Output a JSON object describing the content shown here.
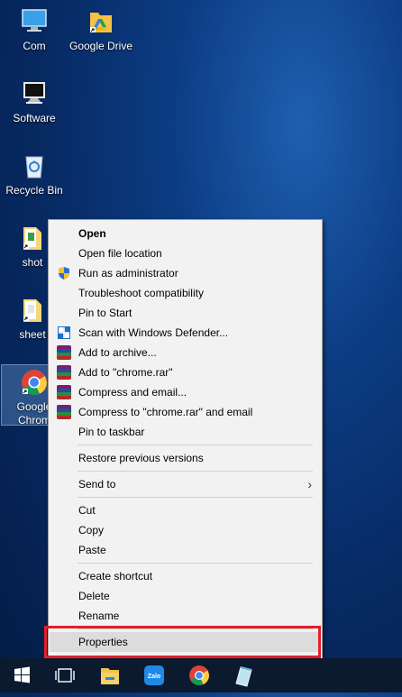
{
  "desktop_icons": [
    {
      "label": "Com",
      "icon": "computer-icon"
    },
    {
      "label": "Google Drive",
      "icon": "google-drive-folder-icon"
    },
    {
      "label": "Software",
      "icon": "monitor-icon"
    },
    {
      "label": "Recycle Bin",
      "icon": "recycle-bin-icon"
    },
    {
      "label": "shot",
      "icon": "folder-shortcut-icon"
    },
    {
      "label": "sheet",
      "icon": "folder-shortcut-icon"
    },
    {
      "label_line1": "Google",
      "label_line2": "Chrom",
      "icon": "chrome-icon"
    }
  ],
  "context_menu": {
    "items": [
      {
        "label": "Open"
      },
      {
        "label": "Open file location"
      },
      {
        "label": "Run as administrator",
        "icon": "uac-shield-icon"
      },
      {
        "label": "Troubleshoot compatibility"
      },
      {
        "label": "Pin to Start"
      },
      {
        "label": "Scan with Windows Defender...",
        "icon": "windows-defender-icon"
      },
      {
        "label": "Add to archive...",
        "icon": "winrar-icon"
      },
      {
        "label": "Add to \"chrome.rar\"",
        "icon": "winrar-icon"
      },
      {
        "label": "Compress and email...",
        "icon": "winrar-icon"
      },
      {
        "label": "Compress to \"chrome.rar\" and email",
        "icon": "winrar-icon"
      },
      {
        "label": "Pin to taskbar"
      },
      {
        "label": "Restore previous versions"
      },
      {
        "label": "Send to",
        "submenu_glyph": "›"
      },
      {
        "label": "Cut"
      },
      {
        "label": "Copy"
      },
      {
        "label": "Paste"
      },
      {
        "label": "Create shortcut"
      },
      {
        "label": "Delete"
      },
      {
        "label": "Rename"
      },
      {
        "label": "Properties",
        "highlighted": true
      }
    ],
    "highlight_color": "#e0202a"
  },
  "taskbar": {
    "items": [
      "start-icon",
      "task-view-icon",
      "file-explorer-icon",
      "zalo-icon",
      "chrome-icon",
      "pen-app-icon"
    ],
    "zalo_text": "Zalo"
  }
}
